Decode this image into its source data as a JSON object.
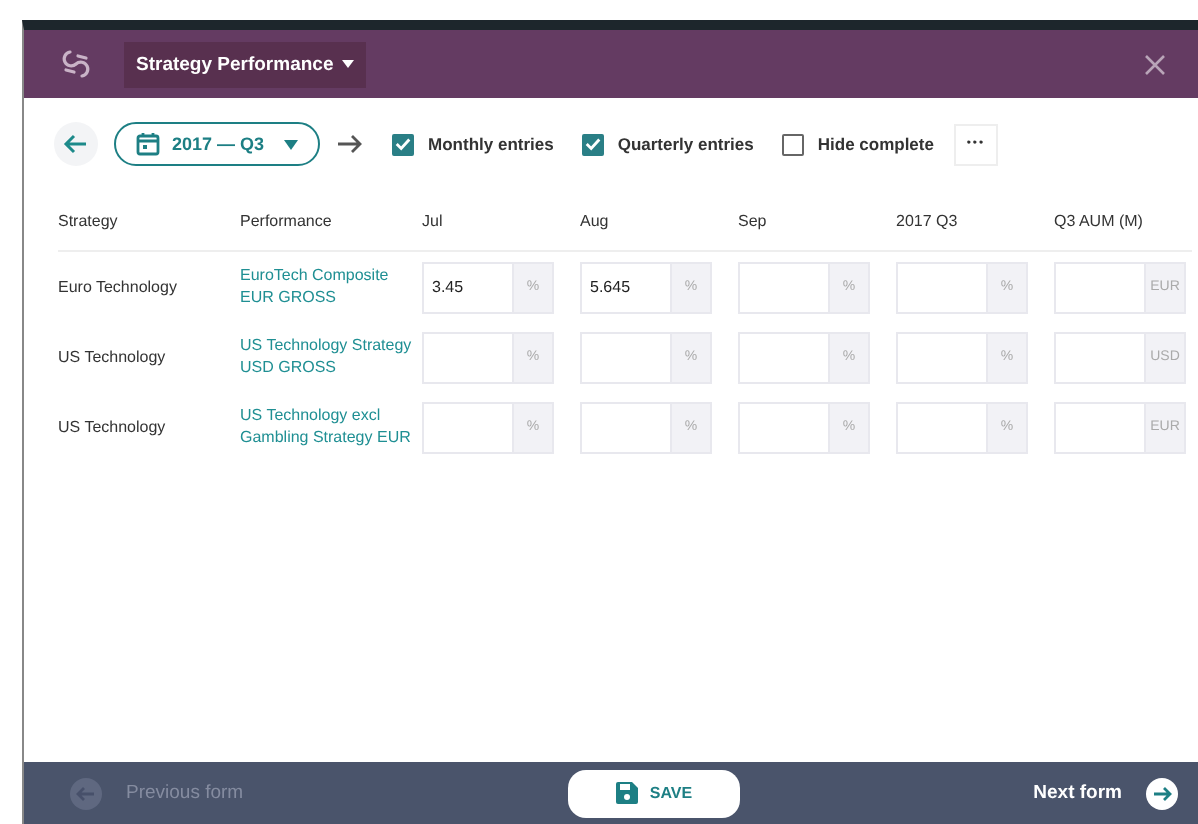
{
  "header": {
    "title": "Strategy Performance"
  },
  "toolbar": {
    "period": "2017 — Q3",
    "options": [
      {
        "label": "Monthly entries",
        "checked": true
      },
      {
        "label": "Quarterly entries",
        "checked": true
      },
      {
        "label": "Hide complete",
        "checked": false
      }
    ],
    "more": "•••"
  },
  "table": {
    "columns": [
      "Strategy",
      "Performance",
      "Jul",
      "Aug",
      "Sep",
      "2017 Q3",
      "Q3 AUM (M)"
    ],
    "rows": [
      {
        "strategy": "Euro Technology",
        "performance": "EuroTech Composite EUR GROSS",
        "cells": [
          {
            "value": "3.45",
            "unit": "%"
          },
          {
            "value": "5.645",
            "unit": "%"
          },
          {
            "unit": "%"
          },
          {
            "unit": "%"
          },
          {
            "unit": "EUR"
          }
        ]
      },
      {
        "strategy": "US Technology",
        "performance": "US Technology Strategy USD GROSS",
        "cells": [
          {
            "unit": "%"
          },
          {
            "unit": "%"
          },
          {
            "unit": "%"
          },
          {
            "unit": "%"
          },
          {
            "unit": "USD"
          }
        ]
      },
      {
        "strategy": "US Technology",
        "performance": "US Technology excl Gambling Strategy EUR",
        "cells": [
          {
            "unit": "%"
          },
          {
            "unit": "%"
          },
          {
            "unit": "%"
          },
          {
            "unit": "%"
          },
          {
            "unit": "EUR"
          }
        ]
      }
    ]
  },
  "footer": {
    "previous": {
      "label": "Previous form",
      "disabled": true
    },
    "save": "SAVE",
    "next": {
      "label": "Next form",
      "disabled": false
    }
  }
}
